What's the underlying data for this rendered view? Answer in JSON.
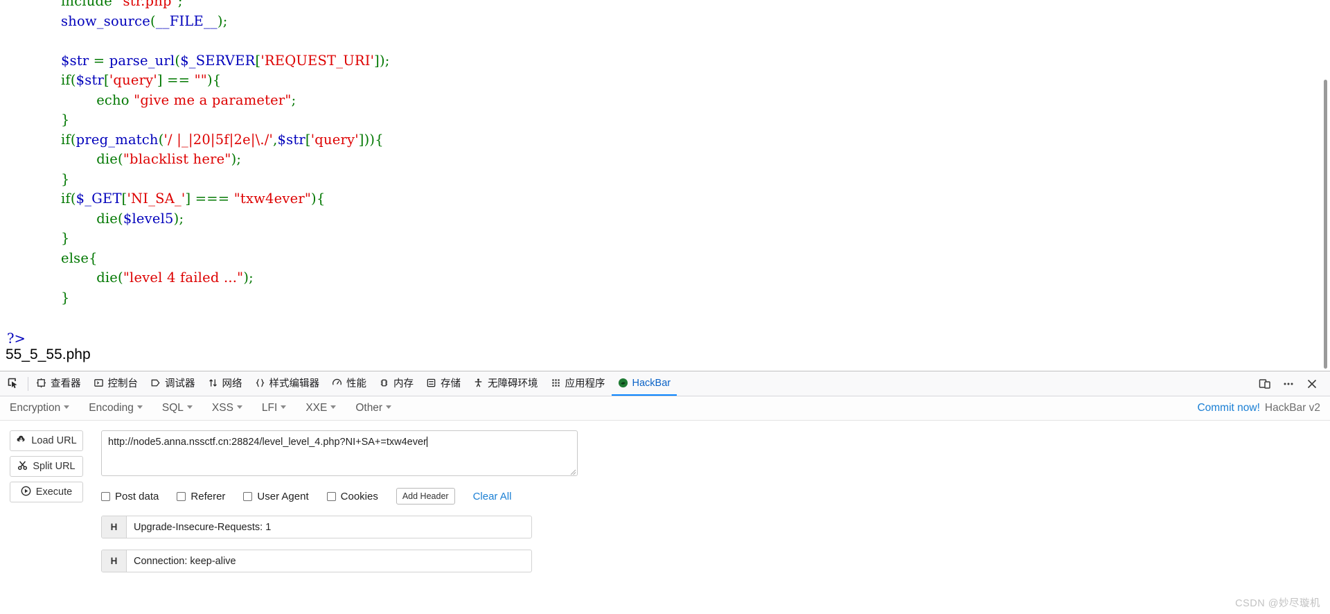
{
  "page": {
    "code_lines": [
      [
        {
          "t": "include ",
          "c": "g"
        },
        {
          "t": "\"str.php\"",
          "c": "r"
        },
        {
          "t": ";",
          "c": "g"
        }
      ],
      [
        {
          "t": "show_source",
          "c": "k"
        },
        {
          "t": "(",
          "c": "g"
        },
        {
          "t": "__FILE__",
          "c": "k"
        },
        {
          "t": ");",
          "c": "g"
        }
      ],
      [],
      [
        {
          "t": "$str ",
          "c": "k"
        },
        {
          "t": "= ",
          "c": "g"
        },
        {
          "t": "parse_url",
          "c": "k"
        },
        {
          "t": "(",
          "c": "g"
        },
        {
          "t": "$_SERVER",
          "c": "k"
        },
        {
          "t": "[",
          "c": "g"
        },
        {
          "t": "'REQUEST_URI'",
          "c": "r"
        },
        {
          "t": "]);",
          "c": "g"
        }
      ],
      [
        {
          "t": "if",
          "c": "g"
        },
        {
          "t": "(",
          "c": "g"
        },
        {
          "t": "$str",
          "c": "k"
        },
        {
          "t": "[",
          "c": "g"
        },
        {
          "t": "'query'",
          "c": "r"
        },
        {
          "t": "] == ",
          "c": "g"
        },
        {
          "t": "\"\"",
          "c": "r"
        },
        {
          "t": "){",
          "c": "g"
        }
      ],
      [
        {
          "t": "        echo ",
          "c": "g"
        },
        {
          "t": "\"give me a parameter\"",
          "c": "r"
        },
        {
          "t": ";",
          "c": "g"
        }
      ],
      [
        {
          "t": "}",
          "c": "g"
        }
      ],
      [
        {
          "t": "if",
          "c": "g"
        },
        {
          "t": "(",
          "c": "g"
        },
        {
          "t": "preg_match",
          "c": "k"
        },
        {
          "t": "(",
          "c": "g"
        },
        {
          "t": "'/ |_|20|5f|2e|\\./'",
          "c": "r"
        },
        {
          "t": ",",
          "c": "g"
        },
        {
          "t": "$str",
          "c": "k"
        },
        {
          "t": "[",
          "c": "g"
        },
        {
          "t": "'query'",
          "c": "r"
        },
        {
          "t": "])){",
          "c": "g"
        }
      ],
      [
        {
          "t": "        die(",
          "c": "g"
        },
        {
          "t": "\"blacklist here\"",
          "c": "r"
        },
        {
          "t": ");",
          "c": "g"
        }
      ],
      [
        {
          "t": "}",
          "c": "g"
        }
      ],
      [
        {
          "t": "if",
          "c": "g"
        },
        {
          "t": "(",
          "c": "g"
        },
        {
          "t": "$_GET",
          "c": "k"
        },
        {
          "t": "[",
          "c": "g"
        },
        {
          "t": "'NI_SA_'",
          "c": "r"
        },
        {
          "t": "] === ",
          "c": "g"
        },
        {
          "t": "\"txw4ever\"",
          "c": "r"
        },
        {
          "t": "){",
          "c": "g"
        }
      ],
      [
        {
          "t": "        die(",
          "c": "g"
        },
        {
          "t": "$level5",
          "c": "k"
        },
        {
          "t": ");",
          "c": "g"
        }
      ],
      [
        {
          "t": "}",
          "c": "g"
        }
      ],
      [
        {
          "t": "else{",
          "c": "g"
        }
      ],
      [
        {
          "t": "        die(",
          "c": "g"
        },
        {
          "t": "\"level 4 failed ...\"",
          "c": "r"
        },
        {
          "t": ");",
          "c": "g"
        }
      ],
      [
        {
          "t": "}",
          "c": "g"
        }
      ]
    ],
    "php_close_tag": "?>",
    "filename_text": "55_5_55.php"
  },
  "devtools": {
    "picker_icon": "element-picker-icon",
    "tabs": [
      {
        "label": "查看器",
        "icon": "inspector-icon",
        "active": false
      },
      {
        "label": "控制台",
        "icon": "console-icon",
        "active": false
      },
      {
        "label": "调试器",
        "icon": "debugger-icon",
        "active": false
      },
      {
        "label": "网络",
        "icon": "network-icon",
        "active": false
      },
      {
        "label": "样式编辑器",
        "icon": "style-editor-icon",
        "active": false
      },
      {
        "label": "性能",
        "icon": "performance-icon",
        "active": false
      },
      {
        "label": "内存",
        "icon": "memory-icon",
        "active": false
      },
      {
        "label": "存储",
        "icon": "storage-icon",
        "active": false
      },
      {
        "label": "无障碍环境",
        "icon": "accessibility-icon",
        "active": false
      },
      {
        "label": "应用程序",
        "icon": "application-icon",
        "active": false
      },
      {
        "label": "HackBar",
        "icon": "hackbar-icon",
        "active": true
      }
    ],
    "right_buttons": [
      {
        "name": "responsive-design-mode-icon"
      },
      {
        "name": "more-options-icon"
      },
      {
        "name": "close-devtools-icon"
      }
    ],
    "accent_color": "#0a84ff",
    "active_tab_color": "#0a62c7"
  },
  "hackbar": {
    "menus": [
      {
        "label": "Encryption"
      },
      {
        "label": "Encoding"
      },
      {
        "label": "SQL"
      },
      {
        "label": "XSS"
      },
      {
        "label": "LFI"
      },
      {
        "label": "XXE"
      },
      {
        "label": "Other"
      }
    ],
    "commit_label": "Commit now!",
    "version_label": "HackBar v2",
    "buttons": [
      {
        "label": "Load URL",
        "icon": "cloud-download-icon"
      },
      {
        "label": "Split URL",
        "icon": "scissors-icon"
      },
      {
        "label": "Execute",
        "icon": "play-icon"
      }
    ],
    "url_value": "http://node5.anna.nssctf.cn:28824/level_level_4.php?NI+SA+=txw4ever",
    "url_placeholder": "",
    "checkboxes": [
      {
        "label": "Post data",
        "checked": false
      },
      {
        "label": "Referer",
        "checked": false
      },
      {
        "label": "User Agent",
        "checked": false
      },
      {
        "label": "Cookies",
        "checked": false
      }
    ],
    "add_header_label": "Add Header",
    "clear_all_label": "Clear All",
    "headers": [
      {
        "tag": "H",
        "value": "Upgrade-Insecure-Requests: 1"
      },
      {
        "tag": "H",
        "value": "Connection: keep-alive"
      }
    ],
    "link_color": "#1a7fd4"
  },
  "watermark": {
    "text": "CSDN @妙尽璇机"
  }
}
